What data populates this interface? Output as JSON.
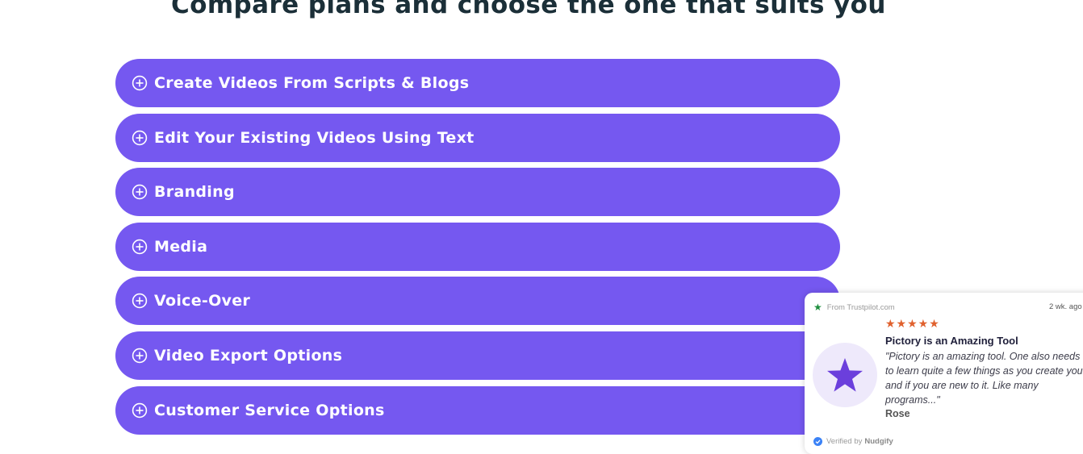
{
  "heading": "Compare plans and choose the one that suits you",
  "accordion": {
    "items": [
      {
        "label": "Create Videos From Scripts & Blogs"
      },
      {
        "label": "Edit Your Existing Videos Using Text"
      },
      {
        "label": "Branding"
      },
      {
        "label": "Media"
      },
      {
        "label": "Voice-Over"
      },
      {
        "label": "Video Export Options"
      },
      {
        "label": "Customer Service Options"
      }
    ]
  },
  "notification": {
    "source": "From Trustpilot.com",
    "time": "2 wk. ago",
    "rating": 5,
    "rating_text": "★★★★★",
    "title": "Pictory is an Amazing Tool",
    "quote": "\"Pictory is an amazing tool. One also needs to learn quite a few things as you create your and if you are new to it. Like many programs...\"",
    "author": "Rose",
    "verified_prefix": "Verified by",
    "verified_brand": "Nudgify"
  },
  "colors": {
    "accordion_bg": "#7558f0",
    "heading": "#1b2f38",
    "rating_star": "#e0612e",
    "avatar_star": "#6b3fdc",
    "trustpilot_star": "#1e8e3e",
    "verified_check": "#3b82f6"
  },
  "icons": {
    "accordion": "plus-circle-icon",
    "source": "trustpilot-star-icon",
    "avatar": "star-icon",
    "verified": "check-circle-icon"
  }
}
